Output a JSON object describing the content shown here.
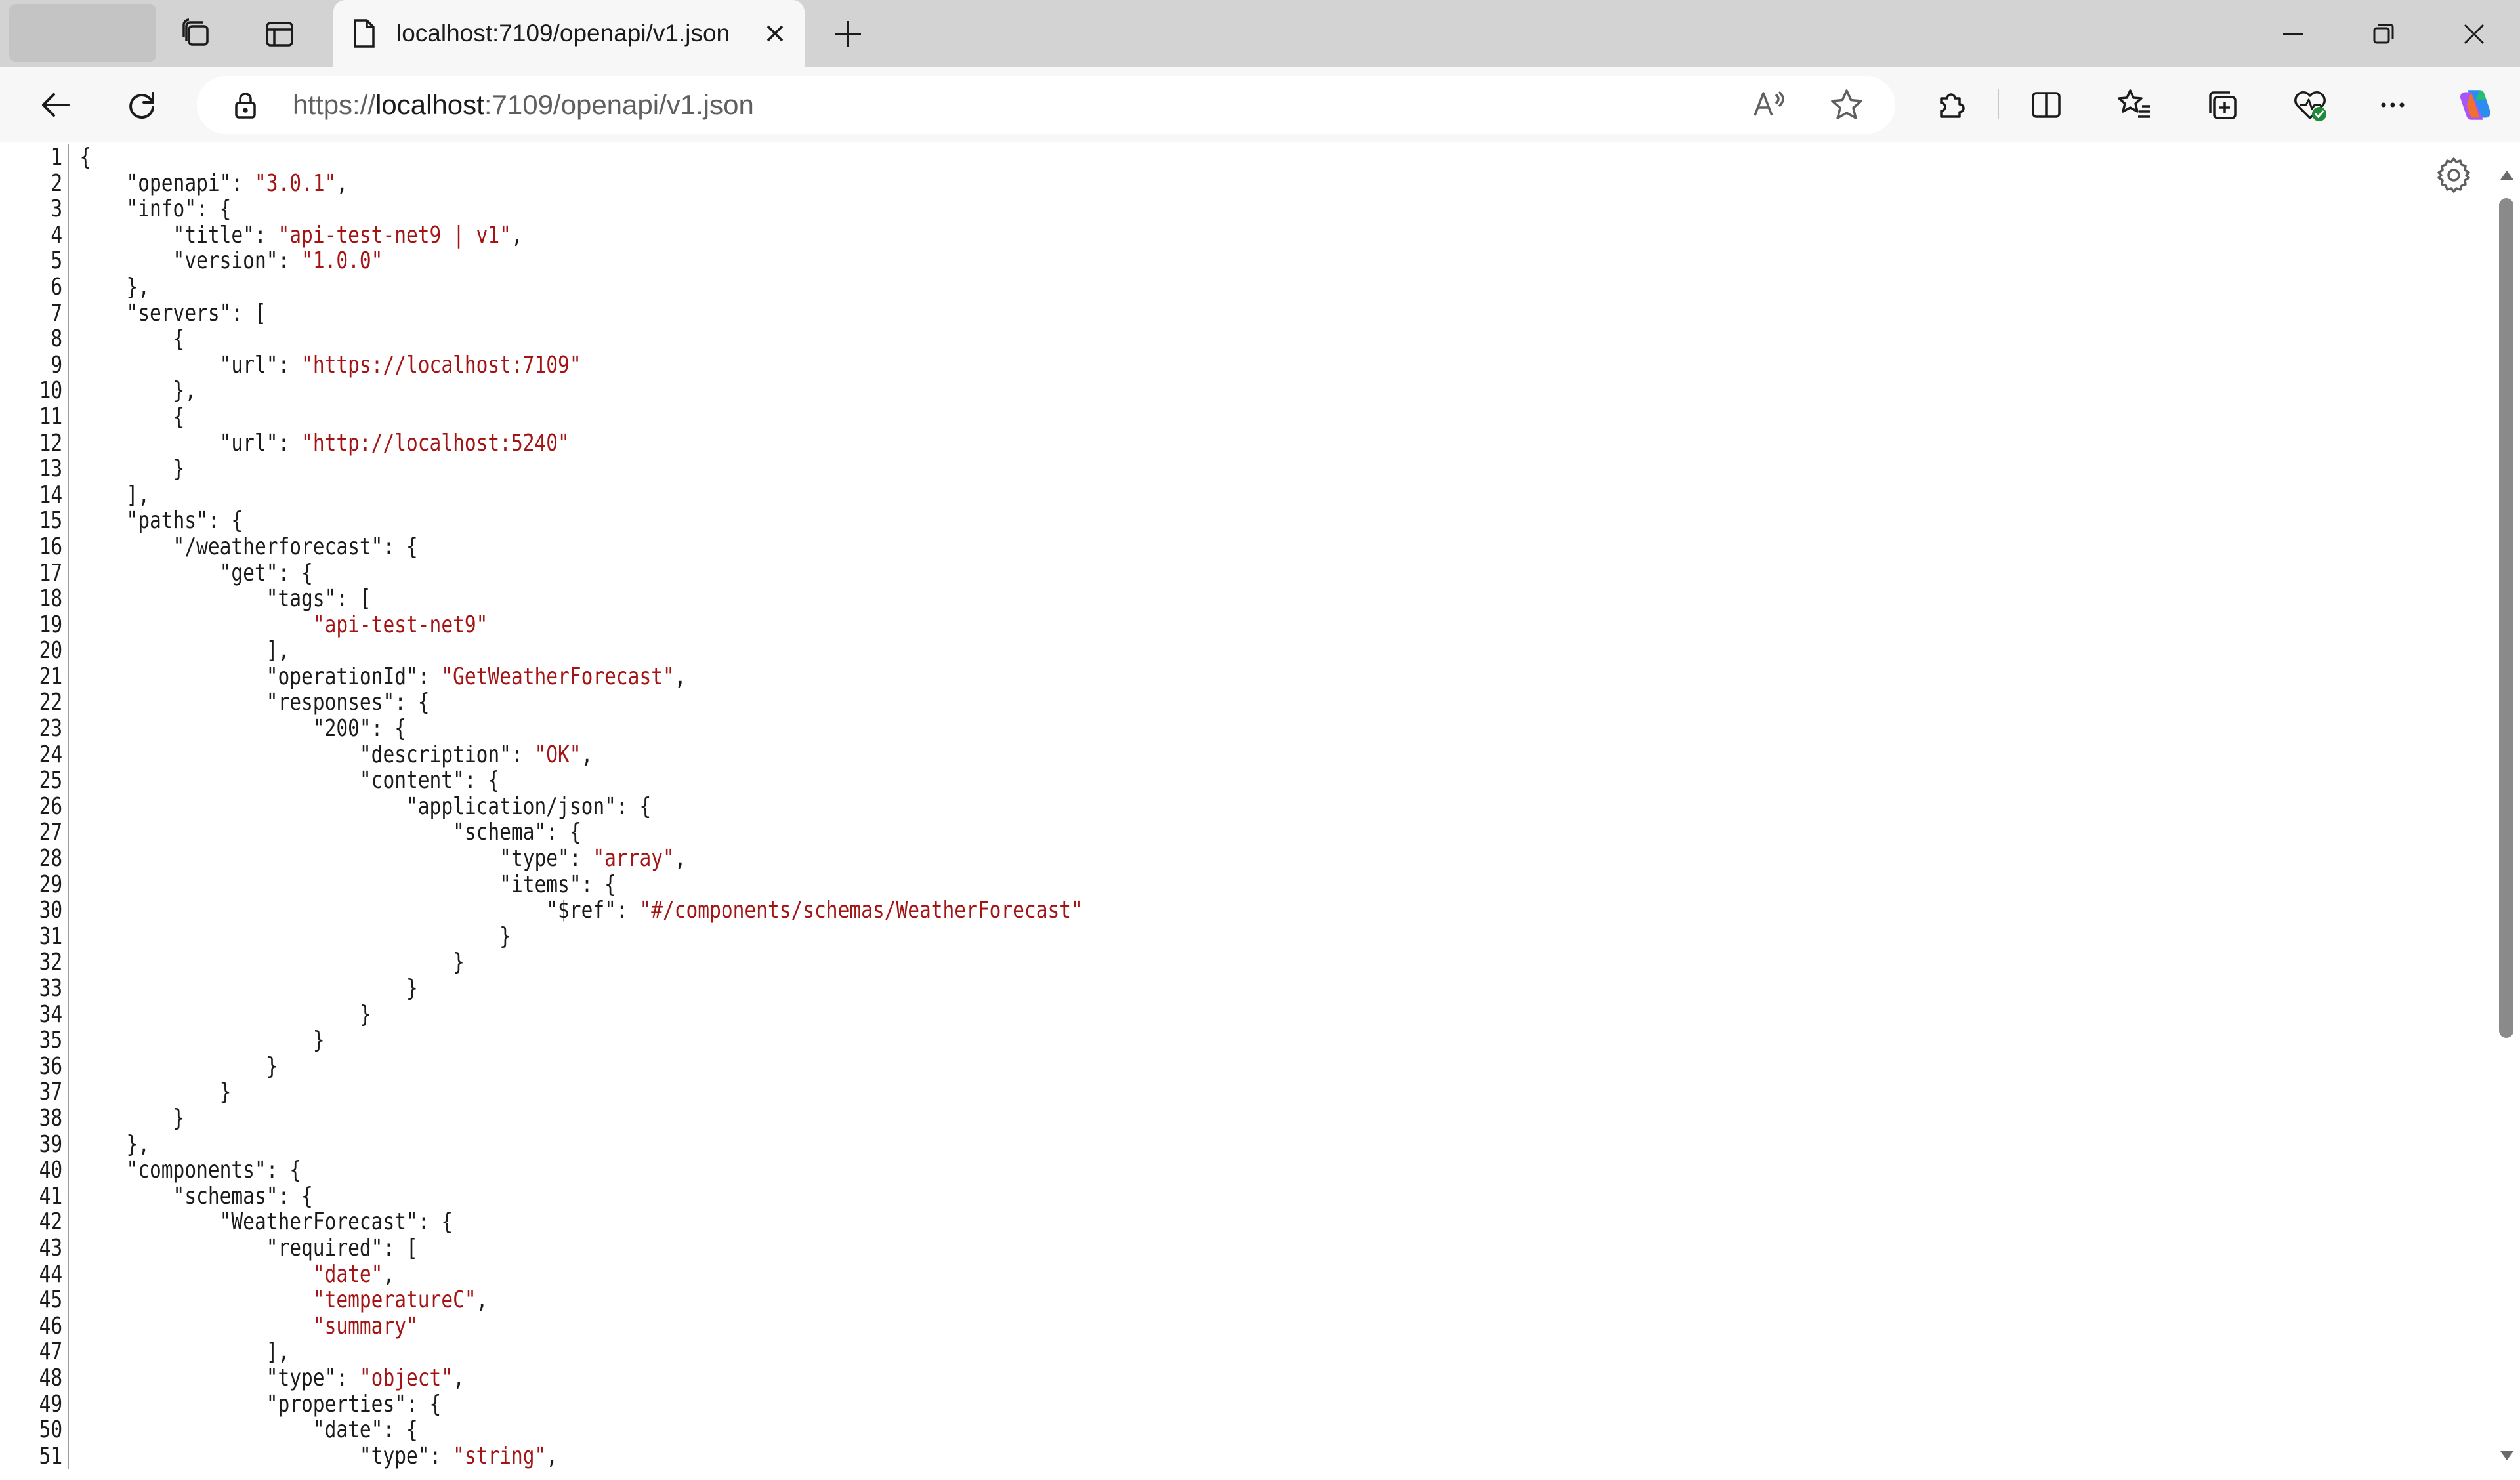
{
  "browser": {
    "tab": {
      "title": "localhost:7109/openapi/v1.json"
    },
    "address": {
      "scheme": "https://",
      "host": "localhost",
      "rest": ":7109/openapi/v1.json"
    }
  },
  "colors": {
    "string": "#a31515",
    "text": "#1b1b1b",
    "tab_strip": "#d3d3d3",
    "toolbar": "#f7f7f7"
  },
  "icons": {
    "tab_strip": [
      "workspaces-icon",
      "vertical-tabs-icon",
      "page-icon",
      "close-tab-icon",
      "new-tab-icon"
    ],
    "window": [
      "minimize-icon",
      "restore-icon",
      "close-window-icon"
    ],
    "toolbar": [
      "back-icon",
      "refresh-icon",
      "lock-icon",
      "read-aloud-icon",
      "favorite-star-icon",
      "extensions-icon",
      "split-screen-icon",
      "favorites-icon",
      "collections-icon",
      "browser-essentials-icon",
      "more-icon",
      "copilot-icon"
    ],
    "content": [
      "settings-gear-icon",
      "scroll-up-icon",
      "scroll-down-icon"
    ]
  },
  "json_view": {
    "lines": [
      {
        "n": "1",
        "indent": "",
        "parts": [
          {
            "t": "{"
          }
        ]
      },
      {
        "n": "2",
        "indent": "    ",
        "parts": [
          {
            "t": "\"openapi\": "
          },
          {
            "s": "\"3.0.1\""
          },
          {
            "t": ","
          }
        ]
      },
      {
        "n": "3",
        "indent": "    ",
        "parts": [
          {
            "t": "\"info\": {"
          }
        ]
      },
      {
        "n": "4",
        "indent": "        ",
        "parts": [
          {
            "t": "\"title\": "
          },
          {
            "s": "\"api-test-net9 | v1\""
          },
          {
            "t": ","
          }
        ]
      },
      {
        "n": "5",
        "indent": "        ",
        "parts": [
          {
            "t": "\"version\": "
          },
          {
            "s": "\"1.0.0\""
          }
        ]
      },
      {
        "n": "6",
        "indent": "    ",
        "parts": [
          {
            "t": "},"
          }
        ]
      },
      {
        "n": "7",
        "indent": "    ",
        "parts": [
          {
            "t": "\"servers\": ["
          }
        ]
      },
      {
        "n": "8",
        "indent": "        ",
        "parts": [
          {
            "t": "{"
          }
        ]
      },
      {
        "n": "9",
        "indent": "            ",
        "parts": [
          {
            "t": "\"url\": "
          },
          {
            "s": "\"https://localhost:7109\""
          }
        ]
      },
      {
        "n": "10",
        "indent": "        ",
        "parts": [
          {
            "t": "},"
          }
        ]
      },
      {
        "n": "11",
        "indent": "        ",
        "parts": [
          {
            "t": "{"
          }
        ]
      },
      {
        "n": "12",
        "indent": "            ",
        "parts": [
          {
            "t": "\"url\": "
          },
          {
            "s": "\"http://localhost:5240\""
          }
        ]
      },
      {
        "n": "13",
        "indent": "        ",
        "parts": [
          {
            "t": "}"
          }
        ]
      },
      {
        "n": "14",
        "indent": "    ",
        "parts": [
          {
            "t": "],"
          }
        ]
      },
      {
        "n": "15",
        "indent": "    ",
        "parts": [
          {
            "t": "\"paths\": {"
          }
        ]
      },
      {
        "n": "16",
        "indent": "        ",
        "parts": [
          {
            "t": "\"/weatherforecast\": {"
          }
        ]
      },
      {
        "n": "17",
        "indent": "            ",
        "parts": [
          {
            "t": "\"get\": {"
          }
        ]
      },
      {
        "n": "18",
        "indent": "                ",
        "parts": [
          {
            "t": "\"tags\": ["
          }
        ]
      },
      {
        "n": "19",
        "indent": "                    ",
        "parts": [
          {
            "s": "\"api-test-net9\""
          }
        ]
      },
      {
        "n": "20",
        "indent": "                ",
        "parts": [
          {
            "t": "],"
          }
        ]
      },
      {
        "n": "21",
        "indent": "                ",
        "parts": [
          {
            "t": "\"operationId\": "
          },
          {
            "s": "\"GetWeatherForecast\""
          },
          {
            "t": ","
          }
        ]
      },
      {
        "n": "22",
        "indent": "                ",
        "parts": [
          {
            "t": "\"responses\": {"
          }
        ]
      },
      {
        "n": "23",
        "indent": "                    ",
        "parts": [
          {
            "t": "\"200\": {"
          }
        ]
      },
      {
        "n": "24",
        "indent": "                        ",
        "parts": [
          {
            "t": "\"description\": "
          },
          {
            "s": "\"OK\""
          },
          {
            "t": ","
          }
        ]
      },
      {
        "n": "25",
        "indent": "                        ",
        "parts": [
          {
            "t": "\"content\": {"
          }
        ]
      },
      {
        "n": "26",
        "indent": "                            ",
        "parts": [
          {
            "t": "\"application/json\": {"
          }
        ]
      },
      {
        "n": "27",
        "indent": "                                ",
        "parts": [
          {
            "t": "\"schema\": {"
          }
        ]
      },
      {
        "n": "28",
        "indent": "                                    ",
        "parts": [
          {
            "t": "\"type\": "
          },
          {
            "s": "\"array\""
          },
          {
            "t": ","
          }
        ]
      },
      {
        "n": "29",
        "indent": "                                    ",
        "parts": [
          {
            "t": "\"items\": {"
          }
        ]
      },
      {
        "n": "30",
        "indent": "                                        ",
        "parts": [
          {
            "t": "\"$ref\": "
          },
          {
            "s": "\"#/components/schemas/WeatherForecast\""
          }
        ]
      },
      {
        "n": "31",
        "indent": "                                    ",
        "parts": [
          {
            "t": "}"
          }
        ]
      },
      {
        "n": "32",
        "indent": "                                ",
        "parts": [
          {
            "t": "}"
          }
        ]
      },
      {
        "n": "33",
        "indent": "                            ",
        "parts": [
          {
            "t": "}"
          }
        ]
      },
      {
        "n": "34",
        "indent": "                        ",
        "parts": [
          {
            "t": "}"
          }
        ]
      },
      {
        "n": "35",
        "indent": "                    ",
        "parts": [
          {
            "t": "}"
          }
        ]
      },
      {
        "n": "36",
        "indent": "                ",
        "parts": [
          {
            "t": "}"
          }
        ]
      },
      {
        "n": "37",
        "indent": "            ",
        "parts": [
          {
            "t": "}"
          }
        ]
      },
      {
        "n": "38",
        "indent": "        ",
        "parts": [
          {
            "t": "}"
          }
        ]
      },
      {
        "n": "39",
        "indent": "    ",
        "parts": [
          {
            "t": "},"
          }
        ]
      },
      {
        "n": "40",
        "indent": "    ",
        "parts": [
          {
            "t": "\"components\": {"
          }
        ]
      },
      {
        "n": "41",
        "indent": "        ",
        "parts": [
          {
            "t": "\"schemas\": {"
          }
        ]
      },
      {
        "n": "42",
        "indent": "            ",
        "parts": [
          {
            "t": "\"WeatherForecast\": {"
          }
        ]
      },
      {
        "n": "43",
        "indent": "                ",
        "parts": [
          {
            "t": "\"required\": ["
          }
        ]
      },
      {
        "n": "44",
        "indent": "                    ",
        "parts": [
          {
            "s": "\"date\""
          },
          {
            "t": ","
          }
        ]
      },
      {
        "n": "45",
        "indent": "                    ",
        "parts": [
          {
            "s": "\"temperatureC\""
          },
          {
            "t": ","
          }
        ]
      },
      {
        "n": "46",
        "indent": "                    ",
        "parts": [
          {
            "s": "\"summary\""
          }
        ]
      },
      {
        "n": "47",
        "indent": "                ",
        "parts": [
          {
            "t": "],"
          }
        ]
      },
      {
        "n": "48",
        "indent": "                ",
        "parts": [
          {
            "t": "\"type\": "
          },
          {
            "s": "\"object\""
          },
          {
            "t": ","
          }
        ]
      },
      {
        "n": "49",
        "indent": "                ",
        "parts": [
          {
            "t": "\"properties\": {"
          }
        ]
      },
      {
        "n": "50",
        "indent": "                    ",
        "parts": [
          {
            "t": "\"date\": {"
          }
        ]
      },
      {
        "n": "51",
        "indent": "                        ",
        "parts": [
          {
            "t": "\"type\": "
          },
          {
            "s": "\"string\""
          },
          {
            "t": ","
          }
        ]
      }
    ]
  }
}
